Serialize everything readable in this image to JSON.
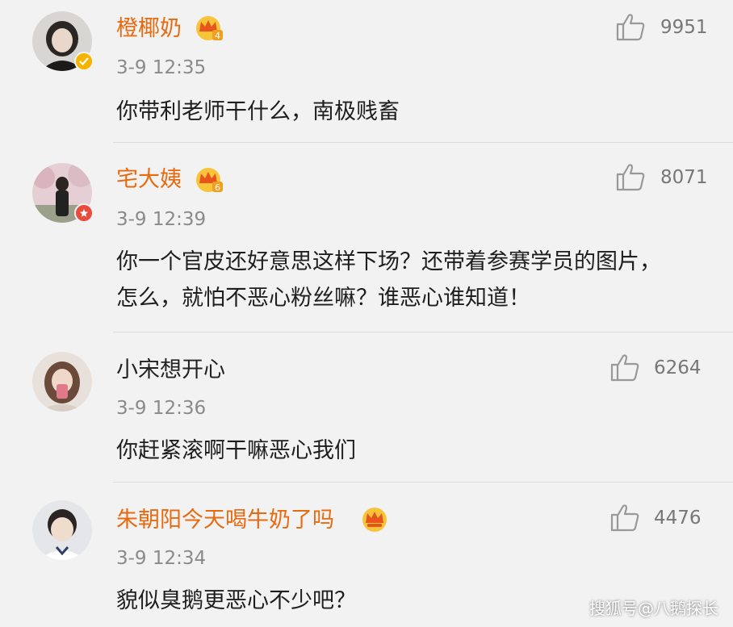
{
  "colors": {
    "vip_name": "#e86a10",
    "meta": "#8a8a8a",
    "background": "#f2f2f2"
  },
  "comments": [
    {
      "username": "橙椰奶",
      "vip_level": "4",
      "time": "3-9 12:35",
      "text": "你带利老师干什么，南极贱畜",
      "likes": "9951",
      "icon": "thumbs-up-icon"
    },
    {
      "username": "宅大姨",
      "vip_level": "6",
      "time": "3-9 12:39",
      "text": "你一个官皮还好意思这样下场？还带着参赛学员的图片，怎么，就怕不恶心粉丝嘛？谁恶心谁知道！",
      "likes": "8071",
      "icon": "thumbs-up-icon"
    },
    {
      "username": "小宋想开心",
      "time": "3-9 12:36",
      "text": "你赶紧滚啊干嘛恶心我们",
      "likes": "6264",
      "icon": "thumbs-up-icon"
    },
    {
      "username": "朱朝阳今天喝牛奶了吗",
      "vip_level": "",
      "time": "3-9 12:34",
      "text": "貌似臭鹅更恶心不少吧？",
      "likes": "4476",
      "icon": "thumbs-up-icon"
    }
  ],
  "watermark": "搜狐号@八鹅探长"
}
